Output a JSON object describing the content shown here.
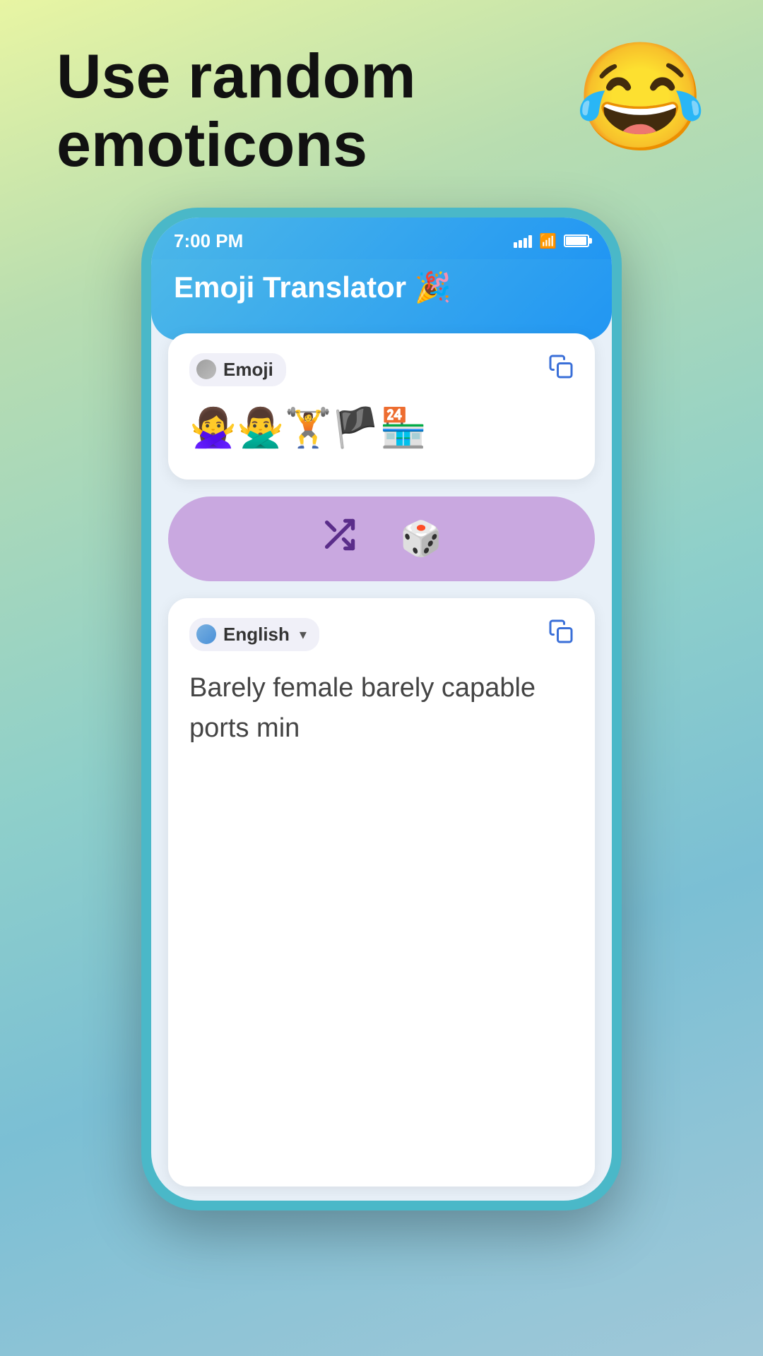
{
  "page": {
    "background": "linear-gradient(160deg, #e8f5a3 0%, #b8ddb0 20%, #8ecfca 50%, #7bbfd4 70%, #a0c8d8 100%)"
  },
  "headline": {
    "text": "Use random emoticons",
    "emoji": "😂"
  },
  "phone": {
    "status_bar": {
      "time": "7:00 PM"
    },
    "app_header": {
      "title": "Emoji Translator 🎉"
    },
    "emoji_card": {
      "lang_label": "Emoji",
      "emojis": "🙅‍♀️🙅‍♂️🏋️🏴🏪",
      "copy_label": "copy"
    },
    "middle_bar": {
      "shuffle_label": "shuffle",
      "dice_label": "dice"
    },
    "translation_card": {
      "lang_label": "English",
      "lang_arrow": "▾",
      "copy_label": "copy",
      "translation_text": "Barely female barely capable ports min"
    }
  }
}
